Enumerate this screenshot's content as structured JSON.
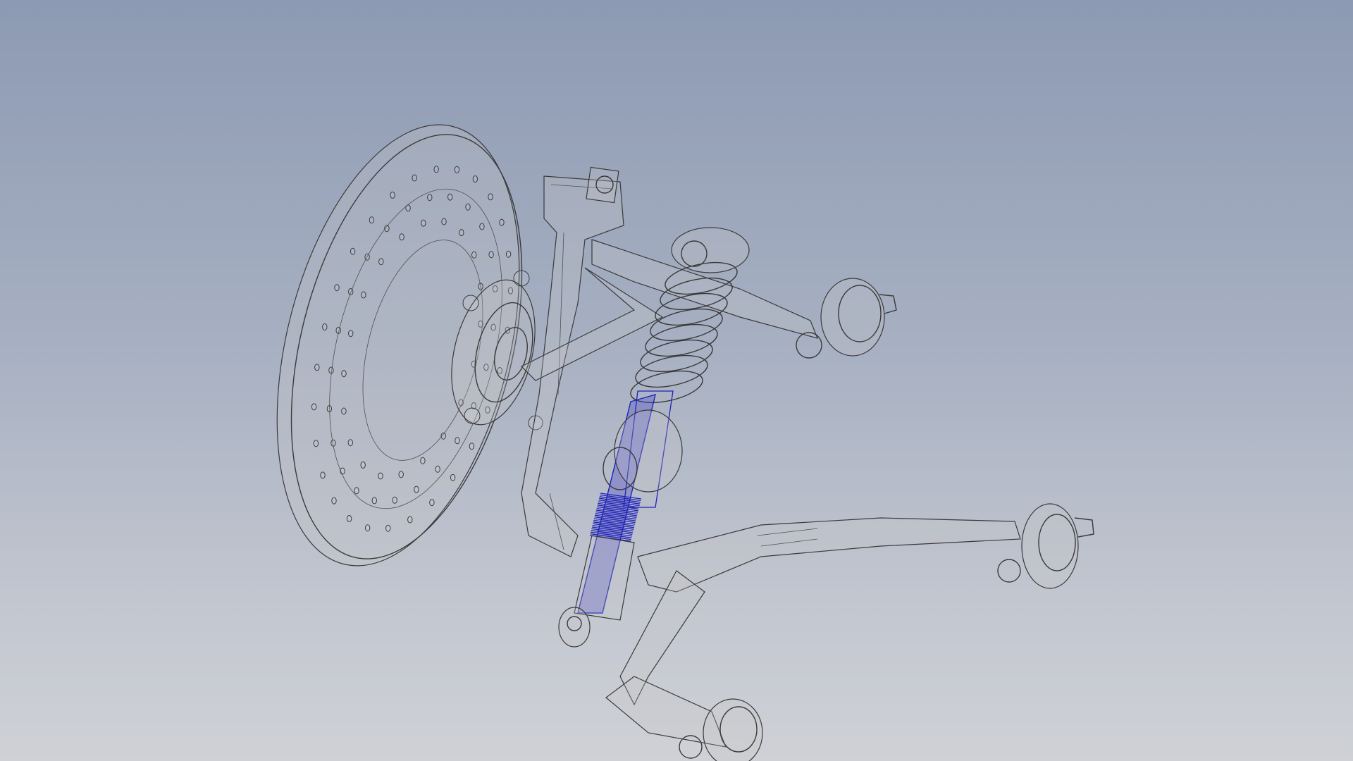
{
  "viewport": {
    "background_top": "#8d9ab3",
    "background_bottom": "#cfd1d6",
    "edge_color": "#3a3a3a",
    "selection_color": "#1f22b8"
  },
  "model": {
    "components": [
      "brake-disc",
      "hub",
      "upright",
      "coil-spring",
      "damper",
      "upper-wishbone",
      "lower-wishbone",
      "bushings"
    ],
    "selected_component": "damper"
  }
}
